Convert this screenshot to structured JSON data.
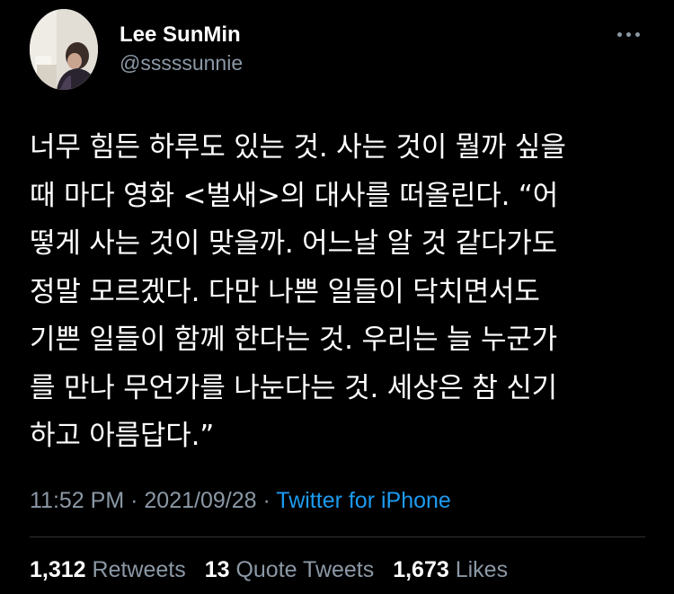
{
  "author": {
    "display_name": "Lee SunMin",
    "handle": "@sssssunnie"
  },
  "tweet": {
    "lines": [
      "너무 힘든 하루도 있는 것. 사는 것이 뭘까 싶을",
      "때 마다 영화 <벌새>의 대사를 떠올린다. “어",
      "떻게 사는 것이 맞을까. 어느날 알 것 같다가도",
      "정말 모르겠다. 다만 나쁜 일들이 닥치면서도",
      "기쁜 일들이 함께 한다는 것. 우리는 늘 누군가",
      "를 만나 무언가를 나눈다는 것. 세상은 참 신기",
      "하고 아름답다.”"
    ]
  },
  "meta": {
    "time": "11:52 PM",
    "separator": "·",
    "date": "2021/09/28",
    "source": "Twitter for iPhone"
  },
  "stats": {
    "retweets_count": "1,312",
    "retweets_label": "Retweets",
    "quotes_count": "13",
    "quotes_label": "Quote Tweets",
    "likes_count": "1,673",
    "likes_label": "Likes"
  },
  "colors": {
    "background": "#000000",
    "text": "#ffffff",
    "secondary": "#8b98a5",
    "link": "#1d9bf0",
    "divider": "#2f3336"
  },
  "icons": {
    "more": "more-horizontal-icon"
  }
}
